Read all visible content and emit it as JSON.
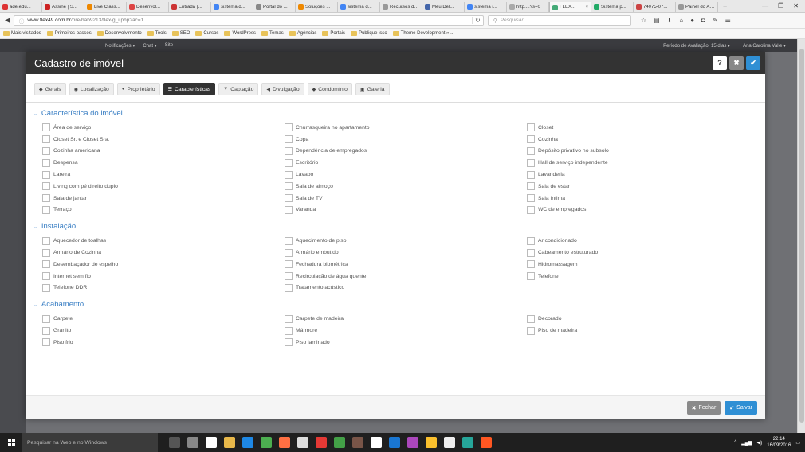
{
  "browser": {
    "tabs": [
      {
        "label": "ade.edu...",
        "color": "#d33"
      },
      {
        "label": "Assine | S...",
        "color": "#c22"
      },
      {
        "label": "Live Class...",
        "color": "#e80"
      },
      {
        "label": "Desenvol...",
        "color": "#d44"
      },
      {
        "label": "Entrada (...",
        "color": "#c33"
      },
      {
        "label": "sistema d...",
        "color": "#4285f4"
      },
      {
        "label": "Portal do ...",
        "color": "#888"
      },
      {
        "label": "Soluções ...",
        "color": "#e80"
      },
      {
        "label": "sistema d...",
        "color": "#4285f4"
      },
      {
        "label": "Recursos do s...",
        "color": "#999"
      },
      {
        "label": "Meu Del...",
        "color": "#46a"
      },
      {
        "label": "sistema i...",
        "color": "#4285f4"
      },
      {
        "label": "http....?s=0",
        "color": "#aaa"
      },
      {
        "label": "FLEX...",
        "color": "#4a7"
      },
      {
        "label": "Sistema p...",
        "color": "#2a6"
      },
      {
        "label": "74075-07...",
        "color": "#c44"
      },
      {
        "label": "Painel do Alu...",
        "color": "#999"
      }
    ],
    "url_domain": "www.flex49.com.br",
    "url_path": "/pre/hab9213/flex/g_i.php?ac=1",
    "search_placeholder": "Pesquisar",
    "bookmarks": [
      "Mais visitados",
      "Primeiros passos",
      "Desenvolvimento",
      "Tools",
      "SEO",
      "Cursos",
      "WordPress",
      "Temas",
      "Agências",
      "Portais",
      "Publique isso",
      "Theme Development »..."
    ]
  },
  "app_topbar": {
    "left": [
      "Notificações ▾",
      "Chat ▾",
      "Site"
    ],
    "period": "Período de Avaliação: 15 dias ▾",
    "user": "Ana Carolina Valle ▾"
  },
  "modal": {
    "title": "Cadastro de imóvel",
    "help_label": "?",
    "close_label": "✖",
    "ok_label": "✔",
    "tabs": [
      {
        "label": "Gerais",
        "icon": "◆",
        "active": false
      },
      {
        "label": "Localização",
        "icon": "◉",
        "active": false
      },
      {
        "label": "Proprietário",
        "icon": "●",
        "active": false
      },
      {
        "label": "Características",
        "icon": "☰",
        "active": true
      },
      {
        "label": "Captação",
        "icon": "▼",
        "active": false
      },
      {
        "label": "Divulgação",
        "icon": "◀",
        "active": false
      },
      {
        "label": "Condomínio",
        "icon": "◆",
        "active": false
      },
      {
        "label": "Galeria",
        "icon": "▣",
        "active": false
      }
    ],
    "sections": [
      {
        "title": "Característica do imóvel",
        "items": [
          "Área de serviço",
          "Churrasqueira no apartamento",
          "Closet",
          "Closet Sr. e Closet Sra.",
          "Copa",
          "Cozinha",
          "Cozinha americana",
          "Dependência de empregados",
          "Depósito privativo no subsolo",
          "Despensa",
          "Escritório",
          "Hall de serviço independente",
          "Lareira",
          "Lavabo",
          "Lavanderia",
          "Living com pé direito duplo",
          "Sala de almoço",
          "Sala de estar",
          "Sala de jantar",
          "Sala de TV",
          "Sala íntima",
          "Terraço",
          "Varanda",
          "WC de empregados"
        ]
      },
      {
        "title": "Instalação",
        "items": [
          "Aquecedor de toalhas",
          "Aquecimento de piso",
          "Ar condicionado",
          "Armário de Cozinha",
          "Armário embutido",
          "Cabeamento estruturado",
          "Desembaçador de espelho",
          "Fechadura biométrica",
          "Hidromassagem",
          "Internet sem fio",
          "Recirculação de água quente",
          "Telefone",
          "Telefone DDR",
          "Tratamento acústico"
        ]
      },
      {
        "title": "Acabamento",
        "items": [
          "Carpete",
          "Carpete de madeira",
          "Decorado",
          "Granito",
          "Mármore",
          "Piso de madeira",
          "Piso frio",
          "Piso laminado"
        ]
      }
    ],
    "footer": {
      "close_label": "Fechar",
      "save_label": "Salvar"
    }
  },
  "taskbar": {
    "search_placeholder": "Pesquisar na Web e no Windows",
    "time": "22:14",
    "date": "16/09/2016",
    "apps": [
      "#555",
      "#888",
      "#fff",
      "#e8b84a",
      "#1e88e5",
      "#4caf50",
      "#ff7043",
      "#ddd",
      "#e53935",
      "#43a047",
      "#795548",
      "#fff",
      "#1976d2",
      "#ab47bc",
      "#fbc02d",
      "#eee",
      "#26a69a",
      "#ff5722"
    ]
  }
}
